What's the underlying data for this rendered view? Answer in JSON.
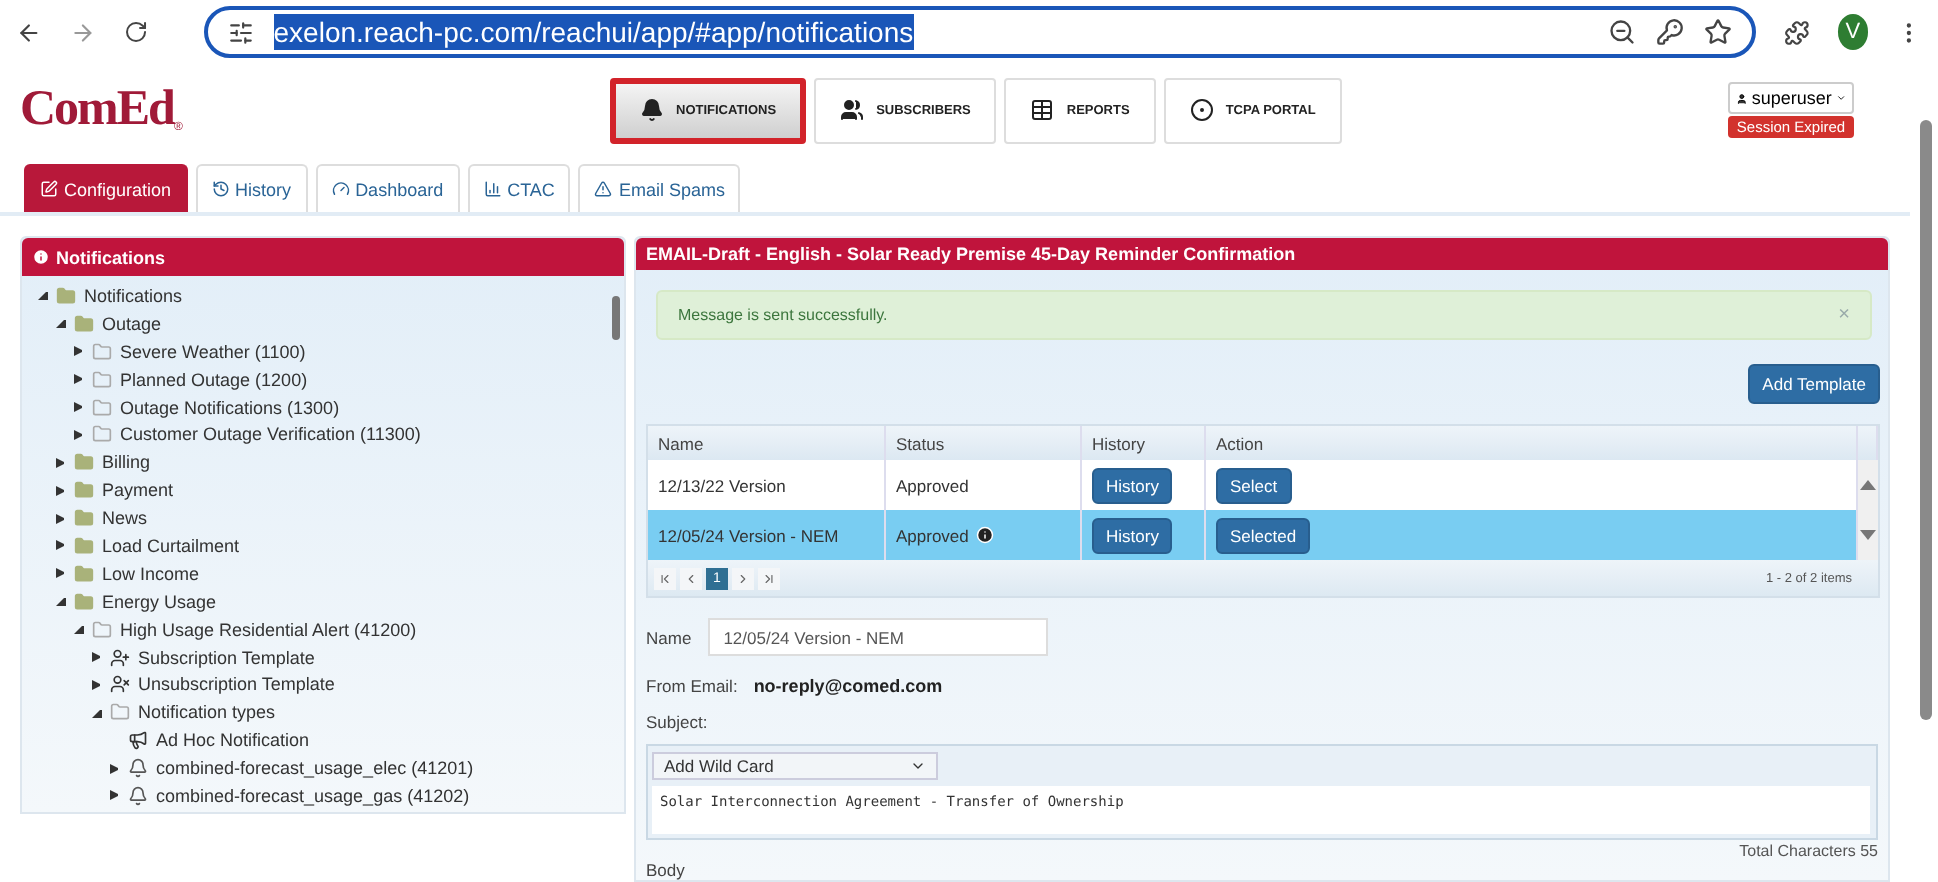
{
  "browser": {
    "url": "exelon.reach-pc.com/reachui/app/#app/notifications",
    "url_selected": true,
    "profile_initial": "V"
  },
  "logo": {
    "name": "ComEd",
    "mark": "®"
  },
  "nav": [
    {
      "label": "NOTIFICATIONS",
      "kind": "bell",
      "selected": true
    },
    {
      "label": "SUBSCRIBERS",
      "kind": "users",
      "selected": false
    },
    {
      "label": "REPORTS",
      "kind": "table",
      "selected": false
    },
    {
      "label": "TCPA PORTAL",
      "kind": "target",
      "selected": false
    }
  ],
  "user": {
    "name": "superuser",
    "status": "Session Expired"
  },
  "tabs": [
    {
      "label": "Configuration",
      "kind": "edit",
      "selected": true
    },
    {
      "label": "History",
      "kind": "history",
      "selected": false
    },
    {
      "label": "Dashboard",
      "kind": "gauge",
      "selected": false
    },
    {
      "label": "CTAC",
      "kind": "chart",
      "selected": false
    },
    {
      "label": "Email Spams",
      "kind": "warning",
      "selected": false
    }
  ],
  "tree": {
    "title": "Notifications",
    "items": [
      {
        "label": "Notifications",
        "kind": "folder",
        "expandable": true,
        "expanded": true,
        "children": [
          {
            "label": "Outage",
            "kind": "folder",
            "expandable": true,
            "expanded": true,
            "children": [
              {
                "label": "Severe Weather (1100)",
                "kind": "folder-outline",
                "expandable": true,
                "expanded": false
              },
              {
                "label": "Planned Outage (1200)",
                "kind": "folder-outline",
                "expandable": true,
                "expanded": false
              },
              {
                "label": "Outage Notifications (1300)",
                "kind": "folder-outline",
                "expandable": true,
                "expanded": false
              },
              {
                "label": "Customer Outage Verification (11300)",
                "kind": "folder-outline",
                "expandable": true,
                "expanded": false
              }
            ]
          },
          {
            "label": "Billing",
            "kind": "folder",
            "expandable": true,
            "expanded": false
          },
          {
            "label": "Payment",
            "kind": "folder",
            "expandable": true,
            "expanded": false
          },
          {
            "label": "News",
            "kind": "folder",
            "expandable": true,
            "expanded": false
          },
          {
            "label": "Load Curtailment",
            "kind": "folder",
            "expandable": true,
            "expanded": false
          },
          {
            "label": "Low Income",
            "kind": "folder",
            "expandable": true,
            "expanded": false
          },
          {
            "label": "Energy Usage",
            "kind": "folder",
            "expandable": true,
            "expanded": true,
            "children": [
              {
                "label": "High Usage Residential Alert (41200)",
                "kind": "folder-outline",
                "expandable": true,
                "expanded": true,
                "children": [
                  {
                    "label": "Subscription Template",
                    "kind": "user-add",
                    "expandable": true,
                    "expanded": false
                  },
                  {
                    "label": "Unsubscription Template",
                    "kind": "user-remove",
                    "expandable": true,
                    "expanded": false
                  },
                  {
                    "label": "Notification types",
                    "kind": "folder-outline",
                    "expandable": true,
                    "expanded": true,
                    "children": [
                      {
                        "label": "Ad Hoc Notification",
                        "kind": "megaphone",
                        "expandable": false,
                        "expanded": false
                      },
                      {
                        "label": "combined-forecast_usage_elec (41201)",
                        "kind": "bell",
                        "expandable": true,
                        "expanded": false
                      },
                      {
                        "label": "combined-forecast_usage_gas (41202)",
                        "kind": "bell",
                        "expandable": true,
                        "expanded": false
                      }
                    ]
                  }
                ]
              }
            ]
          }
        ]
      }
    ]
  },
  "detail": {
    "title": "EMAIL-Draft - English - Solar Ready Premise 45-Day Reminder Confirmation",
    "alert": {
      "message": "Message is sent successfully.",
      "close": "×"
    },
    "add_button": "Add Template",
    "grid": {
      "columns": [
        "Name",
        "Status",
        "History",
        "Action"
      ],
      "rows": [
        {
          "name": "12/13/22 Version",
          "status": "Approved",
          "info": false,
          "history": "History",
          "action": "Select",
          "selected": false
        },
        {
          "name": "12/05/24 Version - NEM",
          "status": "Approved",
          "info": true,
          "history": "History",
          "action": "Selected",
          "selected": true
        }
      ],
      "pages": [
        {
          "label": "1",
          "selected": true
        }
      ],
      "summary": "1 - 2 of 2 items"
    },
    "name_label": "Name",
    "name_value": "12/05/24 Version - NEM",
    "from_label": "From Email:",
    "from_value": "no-reply@comed.com",
    "subject_label": "Subject:",
    "wildcard": "Add Wild Card",
    "subject_value": "Solar Interconnection Agreement - Transfer of Ownership",
    "total": "Total Characters 55",
    "body_label": "Body"
  }
}
